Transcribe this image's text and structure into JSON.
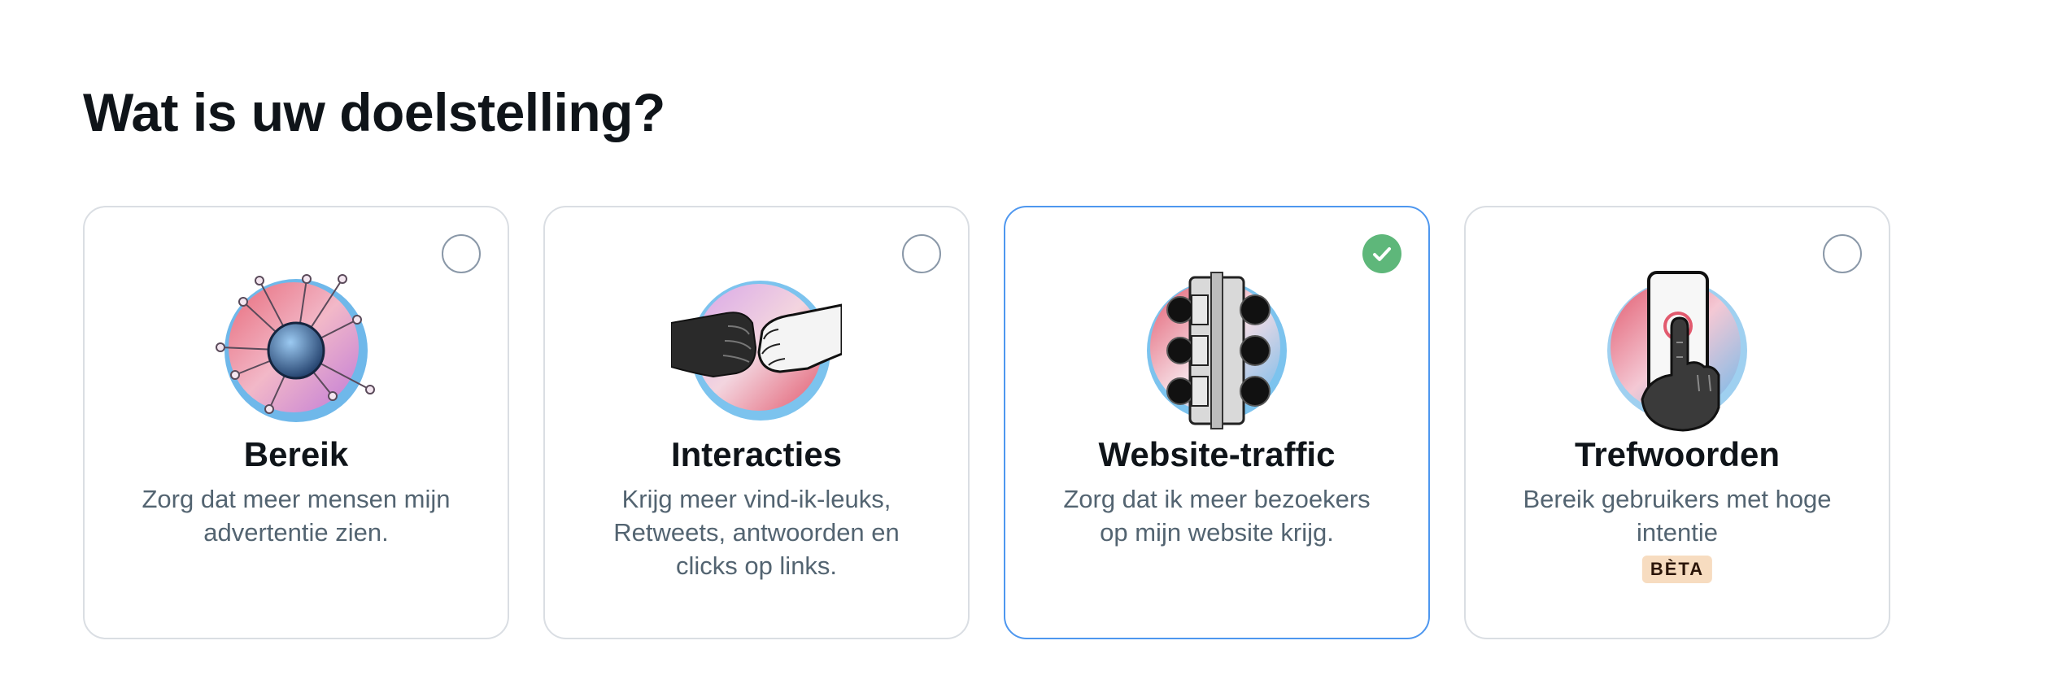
{
  "page": {
    "title": "Wat is uw doelstelling?"
  },
  "colors": {
    "selected_border": "#4e97ef",
    "check_fill": "#5eb77a",
    "beta_bg": "#f7dcc0",
    "description_text": "#536471"
  },
  "options": [
    {
      "title": "Bereik",
      "description": "Zorg dat meer mensen mijn advertentie zien.",
      "selected": false,
      "icon": "reach-network-icon"
    },
    {
      "title": "Interacties",
      "description": "Krijg meer vind-ik-leuks, Retweets, antwoorden en clicks op links.",
      "selected": false,
      "icon": "fist-bump-icon"
    },
    {
      "title": "Website-traffic",
      "description": "Zorg dat ik meer bezoekers op mijn website krijg.",
      "selected": true,
      "icon": "traffic-light-icon"
    },
    {
      "title": "Trefwoorden",
      "description": "Bereik gebruikers met hoge intentie",
      "badge": "BÈTA",
      "selected": false,
      "icon": "phone-tap-icon"
    }
  ]
}
